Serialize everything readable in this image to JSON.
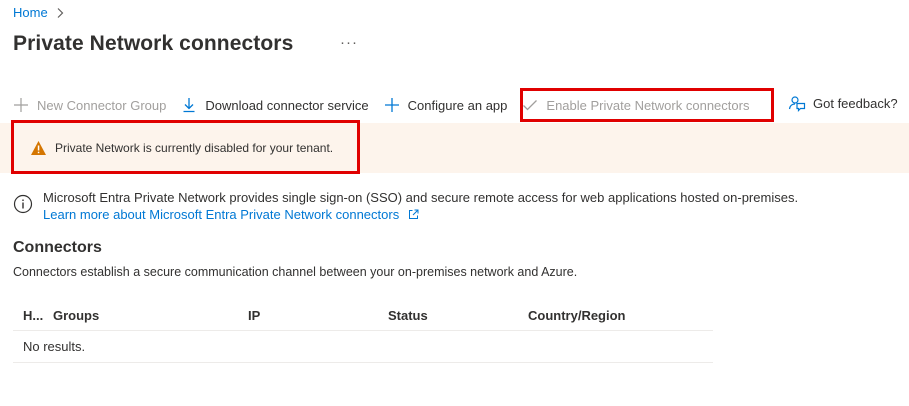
{
  "breadcrumb": {
    "home": "Home"
  },
  "page": {
    "title": "Private Network connectors",
    "more": "···"
  },
  "toolbar": {
    "new_group": "New Connector Group",
    "download": "Download connector service",
    "configure": "Configure an app",
    "enable": "Enable Private Network connectors",
    "feedback": "Got feedback?"
  },
  "banner": {
    "text": "Private Network is currently disabled for your tenant."
  },
  "info": {
    "text": "Microsoft Entra Private Network provides single sign-on (SSO) and secure remote access for web applications hosted on-premises.",
    "link": "Learn more about Microsoft Entra Private Network connectors"
  },
  "connectors": {
    "title": "Connectors",
    "description": "Connectors establish a secure communication channel between your on-premises network and Azure.",
    "columns": [
      "H...",
      "Groups",
      "IP",
      "Status",
      "Country/Region"
    ],
    "empty": "No results."
  },
  "colors": {
    "accent": "#0078d4",
    "warning": "#d47500",
    "highlight": "#e00000",
    "banner_bg": "#fdf4ec"
  }
}
